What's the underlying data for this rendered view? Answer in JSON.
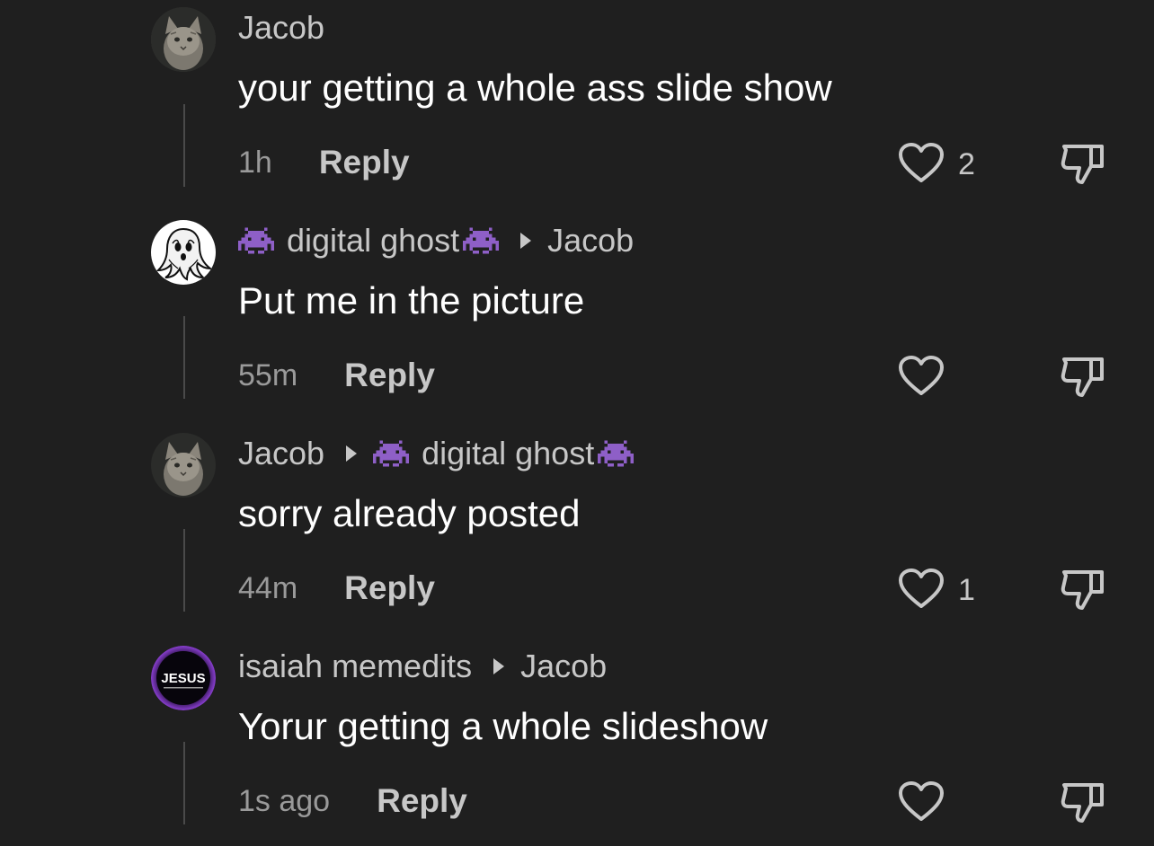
{
  "comments": [
    {
      "author": "Jacob",
      "author_has_invaders": false,
      "reply_to": "",
      "reply_to_has_invaders": false,
      "text": "your getting a whole ass slide show",
      "time": "1h",
      "reply_label": "Reply",
      "likes": "2",
      "avatar": "cat-avatar"
    },
    {
      "author": "digital ghost",
      "author_has_invaders": true,
      "reply_to": "Jacob",
      "reply_to_has_invaders": false,
      "text": "Put me in the picture",
      "time": "55m",
      "reply_label": "Reply",
      "likes": "",
      "avatar": "ghost-avatar"
    },
    {
      "author": "Jacob",
      "author_has_invaders": false,
      "reply_to": "digital ghost",
      "reply_to_has_invaders": true,
      "text": "sorry already posted",
      "time": "44m",
      "reply_label": "Reply",
      "likes": "1",
      "avatar": "cat-avatar"
    },
    {
      "author": "isaiah memedits",
      "author_has_invaders": false,
      "reply_to": "Jacob",
      "reply_to_has_invaders": false,
      "text": "Yorur getting a whole slideshow",
      "time": "1s ago",
      "reply_label": "Reply",
      "likes": "",
      "avatar": "jesus-avatar",
      "avatar_text": "JESUS"
    }
  ],
  "icons": {
    "like": "heart-outline-icon",
    "dislike": "thumbs-down-icon",
    "emoji": "space-invader-icon",
    "separator": "caret-right-icon"
  },
  "colors": {
    "background": "#1f1f1f",
    "text": "#ffffff",
    "secondary_text": "#c7c7c7",
    "muted_text": "#9a9a9a",
    "invader": "#8e5fc7",
    "thread_line": "#4a4a4a"
  }
}
